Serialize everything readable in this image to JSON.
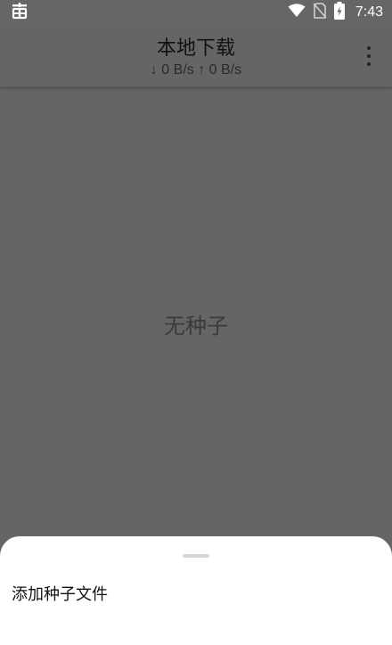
{
  "status_bar": {
    "time": "7:43",
    "icons": [
      "app-notification-icon",
      "wifi-icon",
      "no-sim-icon",
      "battery-charging-icon"
    ]
  },
  "app_bar": {
    "title": "本地下载",
    "speed": "↓ 0 B/s ↑ 0 B/s",
    "menu_icon": "more-vert-icon"
  },
  "main": {
    "empty_message": "无种子"
  },
  "bottom_sheet": {
    "items": [
      {
        "label": "添加种子文件"
      }
    ]
  },
  "colors": {
    "scrim": "#656565",
    "sheet": "#ffffff",
    "handle": "#d6d6d6"
  }
}
